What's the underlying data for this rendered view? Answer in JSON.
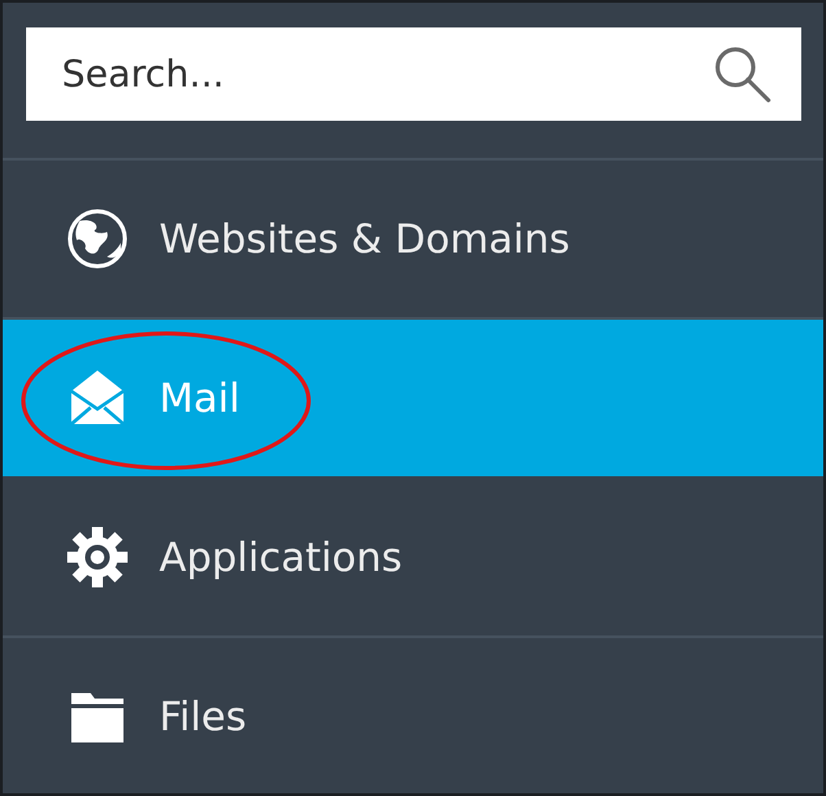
{
  "search": {
    "placeholder": "Search..."
  },
  "nav_items": [
    {
      "kind": "globe",
      "label": "Websites & Domains",
      "selected": false,
      "circled": false
    },
    {
      "kind": "mail",
      "label": "Mail",
      "selected": true,
      "circled": true
    },
    {
      "kind": "gear",
      "label": "Applications",
      "selected": false,
      "circled": false
    },
    {
      "kind": "folder",
      "label": "Files",
      "selected": false,
      "circled": false
    }
  ]
}
